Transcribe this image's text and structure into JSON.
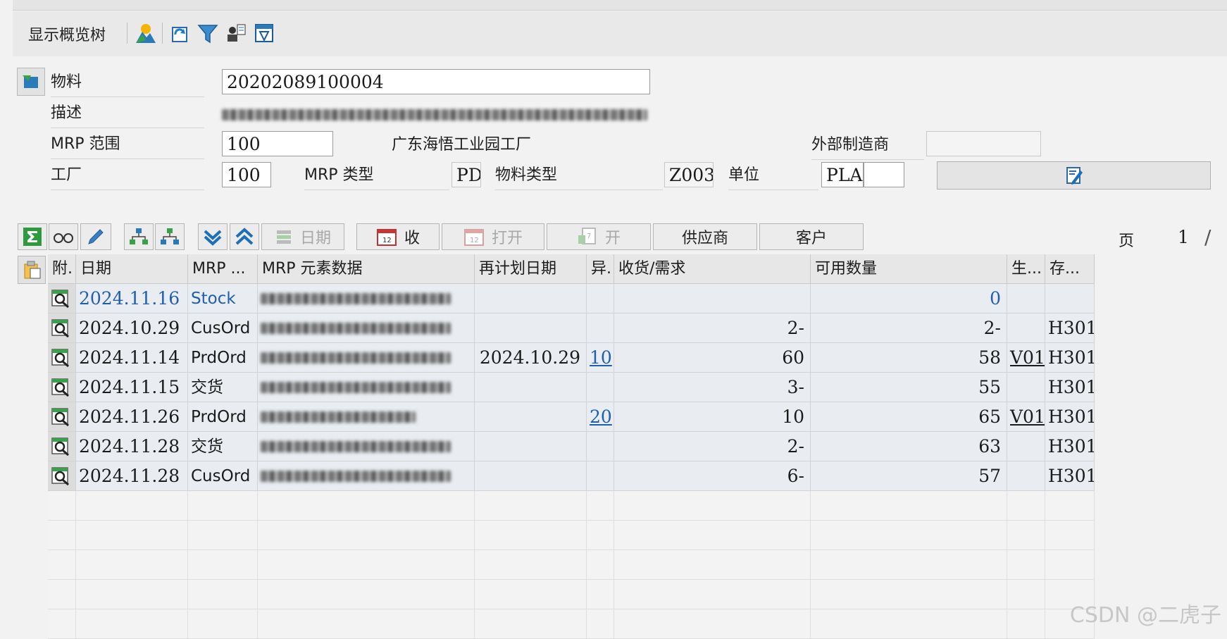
{
  "toolbar": {
    "display_tree_label": "显示概览树",
    "icons": [
      "mountain-chart-icon",
      "refresh-icon",
      "filter-icon",
      "user-list-icon",
      "layout-icon"
    ]
  },
  "header": {
    "material_label": "物料",
    "material_value": "20202089100004",
    "description_label": "描述",
    "mrp_area_label": "MRP 范围",
    "mrp_area_value": "100",
    "plant_desc": "广东海悟工业园工厂",
    "ext_manufacturer_label": "外部制造商",
    "plant_label": "工厂",
    "plant_value": "100",
    "mrp_type_label": "MRP 类型",
    "mrp_type_value": "PD",
    "material_type_label": "物料类型",
    "material_type_value": "Z003",
    "unit_label": "单位",
    "unit_value": "PLA"
  },
  "alv_toolbar": {
    "date_label": "日期",
    "receipt_label": "收",
    "open_label": "打开",
    "open2_label": "开",
    "vendor_label": "供应商",
    "customer_label": "客户",
    "page_label": "页",
    "page_value": "1",
    "page_sep": "/"
  },
  "grid": {
    "columns": [
      "附.",
      "日期",
      "MRP ...",
      "MRP 元素数据",
      "再计划日期",
      "异.",
      "收货/需求",
      "可用数量",
      "生...",
      "存..."
    ],
    "rows": [
      {
        "date": "2024.11.16",
        "mrp_elem": "Stock",
        "reschedule": "",
        "exception": "",
        "qty": "",
        "available": "0",
        "prod": "",
        "storage": ""
      },
      {
        "date": "2024.10.29",
        "mrp_elem": "CusOrd",
        "reschedule": "",
        "exception": "",
        "qty": "2-",
        "available": "2-",
        "prod": "",
        "storage": "H301"
      },
      {
        "date": "2024.11.14",
        "mrp_elem": "PrdOrd",
        "reschedule": "2024.10.29",
        "exception": "10",
        "qty": "60",
        "available": "58",
        "prod": "V01",
        "storage": "H301"
      },
      {
        "date": "2024.11.15",
        "mrp_elem": "交货",
        "reschedule": "",
        "exception": "",
        "qty": "3-",
        "available": "55",
        "prod": "",
        "storage": "H301"
      },
      {
        "date": "2024.11.26",
        "mrp_elem": "PrdOrd",
        "reschedule": "",
        "exception": "20",
        "qty": "10",
        "available": "65",
        "prod": "V01",
        "storage": "H301"
      },
      {
        "date": "2024.11.28",
        "mrp_elem": "交货",
        "reschedule": "",
        "exception": "",
        "qty": "2-",
        "available": "63",
        "prod": "",
        "storage": "H301"
      },
      {
        "date": "2024.11.28",
        "mrp_elem": "CusOrd",
        "reschedule": "",
        "exception": "",
        "qty": "6-",
        "available": "57",
        "prod": "",
        "storage": "H301"
      }
    ]
  },
  "watermark": "CSDN @二虎子",
  "colors": {
    "link": "#1f5fae",
    "row_bg": "#e9edf1",
    "header_bg": "#e7e7e7"
  }
}
